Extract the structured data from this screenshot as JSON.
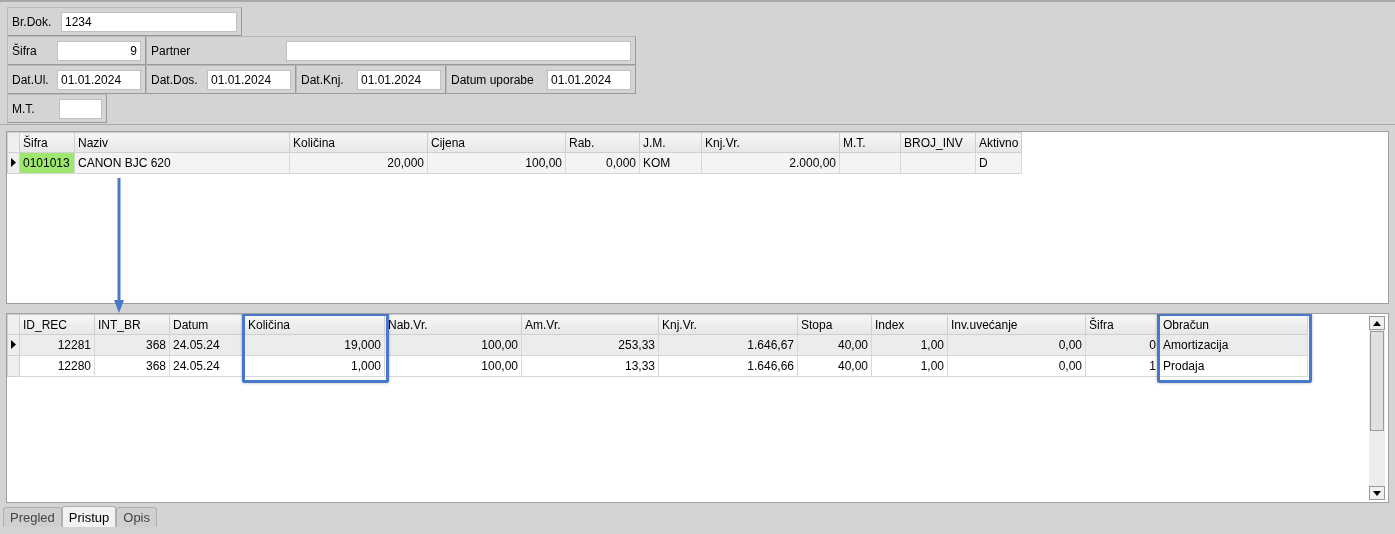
{
  "header_form": {
    "rows": [
      [
        {
          "label": "Br.Dok.",
          "value": "1234"
        }
      ],
      [
        {
          "label": "Šifra",
          "value": "9"
        },
        {
          "label": "Partner"
        }
      ],
      [
        {
          "label": "Dat.Ul.",
          "value": "01.01.2024"
        },
        {
          "label": "Dat.Dos.",
          "value": "01.01.2024"
        },
        {
          "label": "Dat.Knj.",
          "value": "01.01.2024"
        },
        {
          "label": "Datum uporabe",
          "value": "01.01.2024"
        }
      ],
      [
        {
          "label": "M.T."
        }
      ]
    ]
  },
  "items_grid": {
    "columns": [
      {
        "label": "Šifra",
        "highlighted": false
      },
      {
        "label": "Naziv",
        "highlighted": false
      },
      {
        "label": "Količina",
        "highlighted": false
      },
      {
        "label": "Cijena",
        "highlighted": false
      },
      {
        "label": "Rab.",
        "highlighted": false
      },
      {
        "label": "J.M.",
        "highlighted": false
      },
      {
        "label": "Knj.Vr.",
        "highlighted": false
      },
      {
        "label": "M.T.",
        "highlighted": false
      },
      {
        "label": "BROJ_INV",
        "highlighted": false
      },
      {
        "label": "Aktivno",
        "highlighted": false
      }
    ],
    "rows": [
      {
        "selected": true,
        "cells": [
          "0101013",
          "CANON BJC 620",
          "20,000",
          "100,00",
          "0,000",
          "KOM",
          "2.000,00",
          "",
          "",
          "D"
        ]
      }
    ]
  },
  "records_grid": {
    "columns": [
      {
        "label": "ID_REC",
        "highlighted": false
      },
      {
        "label": "INT_BR",
        "highlighted": false
      },
      {
        "label": "Datum",
        "highlighted": false
      },
      {
        "label": "Količina",
        "highlighted": true
      },
      {
        "label": "Nab.Vr.",
        "highlighted": false
      },
      {
        "label": "Am.Vr.",
        "highlighted": false
      },
      {
        "label": "Knj.Vr.",
        "highlighted": false
      },
      {
        "label": "Stopa",
        "highlighted": false
      },
      {
        "label": "Index",
        "highlighted": false
      },
      {
        "label": "Inv.uvećanje",
        "highlighted": false
      },
      {
        "label": "Šifra",
        "highlighted": false
      },
      {
        "label": "Obračun",
        "highlighted": true
      }
    ],
    "rows": [
      {
        "selected": true,
        "cells": [
          "12281",
          "368",
          "24.05.24",
          "19,000",
          "100,00",
          "253,33",
          "1.646,67",
          "40,00",
          "1,00",
          "0,00",
          "0",
          "Amortizacija"
        ]
      },
      {
        "selected": false,
        "cells": [
          "12280",
          "368",
          "24.05.24",
          "1,000",
          "100,00",
          "13,33",
          "1.646,66",
          "40,00",
          "1,00",
          "0,00",
          "1",
          "Prodaja"
        ]
      }
    ]
  },
  "tabs": [
    {
      "label": "Pregled",
      "selected": false
    },
    {
      "label": "Pristup",
      "selected": true
    },
    {
      "label": "Opis",
      "selected": false
    }
  ]
}
